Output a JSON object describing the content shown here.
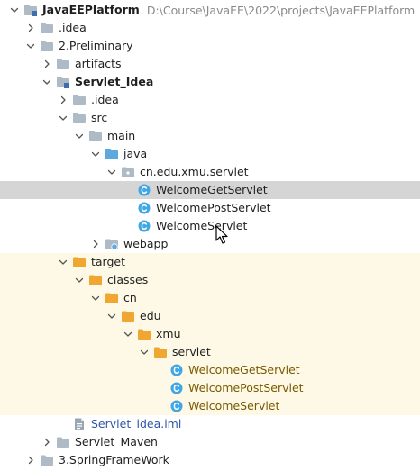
{
  "colors": {
    "folder": "#aebbc7",
    "folder_excluded": "#f0a732",
    "folder_source": "#5fa8de",
    "class_circle": "#41a6e3",
    "excluded_bg": "#fdf9e6",
    "selected_bg": "#d5d5d5",
    "excluded_text": "#7a5a00",
    "link_text": "#2e55a6"
  },
  "project": {
    "root_label": "JavaEEPlatform",
    "root_path": "D:\\Course\\JavaEE\\2022\\projects\\JavaEEPlatform"
  },
  "tree": [
    {
      "label": "JavaEEPlatform",
      "icon": "module-folder-icon",
      "indent": 0,
      "expanded": true,
      "bold": true
    },
    {
      "label": ".idea",
      "icon": "folder-icon",
      "indent": 1,
      "expanded": false
    },
    {
      "label": "2.Preliminary",
      "icon": "folder-icon",
      "indent": 1,
      "expanded": true
    },
    {
      "label": "artifacts",
      "icon": "folder-icon",
      "indent": 2,
      "expanded": false
    },
    {
      "label": "Servlet_Idea",
      "icon": "module-folder-icon",
      "indent": 2,
      "expanded": true,
      "bold": true
    },
    {
      "label": ".idea",
      "icon": "folder-icon",
      "indent": 3,
      "expanded": false
    },
    {
      "label": "src",
      "icon": "folder-icon",
      "indent": 3,
      "expanded": true
    },
    {
      "label": "main",
      "icon": "folder-icon",
      "indent": 4,
      "expanded": true
    },
    {
      "label": "java",
      "icon": "source-folder-icon",
      "indent": 5,
      "expanded": true
    },
    {
      "label": "cn.edu.xmu.servlet",
      "icon": "package-icon",
      "indent": 6,
      "expanded": true
    },
    {
      "label": "WelcomeGetServlet",
      "icon": "class-icon",
      "indent": 7,
      "selected": true
    },
    {
      "label": "WelcomePostServlet",
      "icon": "class-icon",
      "indent": 7
    },
    {
      "label": "WelcomeServlet",
      "icon": "class-icon",
      "indent": 7
    },
    {
      "label": "webapp",
      "icon": "web-folder-icon",
      "indent": 5,
      "expanded": false
    },
    {
      "label": "target",
      "icon": "excluded-folder-icon",
      "indent": 3,
      "expanded": true,
      "excluded": true
    },
    {
      "label": "classes",
      "icon": "excluded-folder-icon",
      "indent": 4,
      "expanded": true,
      "excluded": true
    },
    {
      "label": "cn",
      "icon": "excluded-folder-icon",
      "indent": 5,
      "expanded": true,
      "excluded": true
    },
    {
      "label": "edu",
      "icon": "excluded-folder-icon",
      "indent": 6,
      "expanded": true,
      "excluded": true
    },
    {
      "label": "xmu",
      "icon": "excluded-folder-icon",
      "indent": 7,
      "expanded": true,
      "excluded": true
    },
    {
      "label": "servlet",
      "icon": "excluded-folder-icon",
      "indent": 8,
      "expanded": true,
      "excluded": true
    },
    {
      "label": "WelcomeGetServlet",
      "icon": "class-icon",
      "indent": 9,
      "excluded": true
    },
    {
      "label": "WelcomePostServlet",
      "icon": "class-icon",
      "indent": 9,
      "excluded": true
    },
    {
      "label": "WelcomeServlet",
      "icon": "class-icon",
      "indent": 9,
      "excluded": true
    },
    {
      "label": "Servlet_idea.iml",
      "icon": "iml-file-icon",
      "indent": 3,
      "link": true
    },
    {
      "label": "Servlet_Maven",
      "icon": "folder-icon",
      "indent": 2,
      "expanded": false
    },
    {
      "label": "3.SpringFrameWork",
      "icon": "folder-icon",
      "indent": 1,
      "expanded": false
    }
  ]
}
